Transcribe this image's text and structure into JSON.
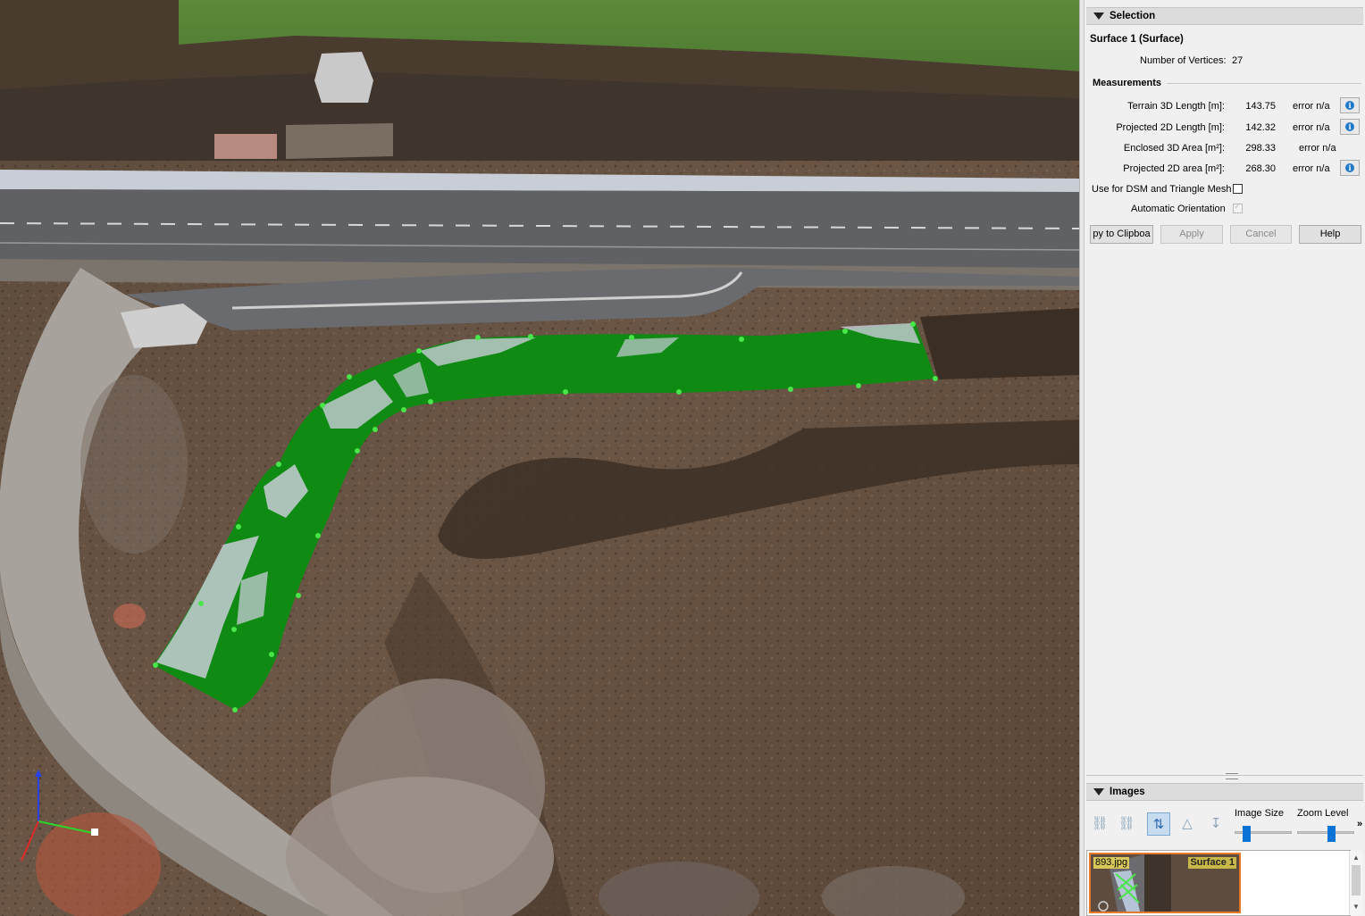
{
  "selection": {
    "header": "Selection",
    "title": "Surface 1 (Surface)",
    "vertices_label": "Number of Vertices:",
    "vertices_value": "27",
    "measurements_header": "Measurements",
    "rows": [
      {
        "label": "Terrain 3D Length [m]:",
        "value": "143.75",
        "error": "error n/a",
        "info": true
      },
      {
        "label": "Projected 2D Length [m]:",
        "value": "142.32",
        "error": "error n/a",
        "info": true
      },
      {
        "label": "Enclosed 3D Area [m²]:",
        "value": "298.33",
        "error": "error n/a",
        "info": false
      },
      {
        "label": "Projected 2D area [m²]:",
        "value": "268.30",
        "error": "error n/a",
        "info": true
      }
    ],
    "use_for_dsm_label": "Use for DSM and Triangle Mesh",
    "use_for_dsm_checked": false,
    "auto_orientation_label": "Automatic Orientation",
    "auto_orientation_checked": true,
    "buttons": {
      "copy": "py to Clipboa",
      "apply": "Apply",
      "cancel": "Cancel",
      "help": "Help"
    }
  },
  "images": {
    "header": "Images",
    "image_size_label": "Image Size",
    "zoom_level_label": "Zoom Level",
    "more": "»",
    "thumb_name": "893.jpg",
    "thumb_tag": "Surface 1"
  },
  "colors": {
    "surface_fill": "#0f8a12",
    "vertex": "#49e649",
    "accent": "#0a74d6",
    "thumb_border": "#e6782a"
  }
}
